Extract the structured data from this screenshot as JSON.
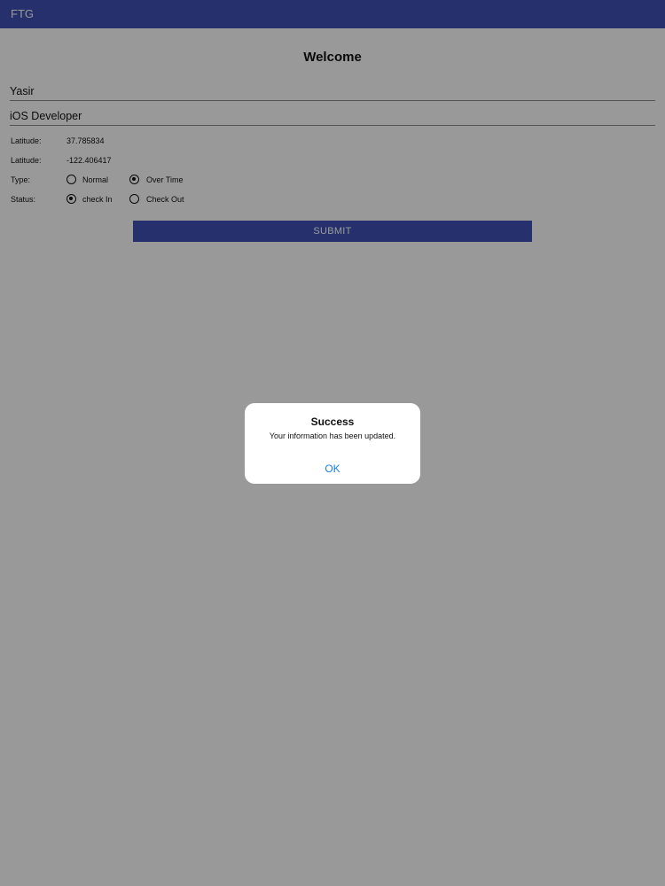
{
  "navbar": {
    "title": "FTG",
    "color": "#3f51b5"
  },
  "form": {
    "title": "Welcome",
    "name_value": "Yasir",
    "role_value": "iOS Developer",
    "latitude_label": "Latitude:",
    "latitude_value": "37.785834",
    "longitude_label": "Latitude:",
    "longitude_value": "-122.406417",
    "type": {
      "label": "Type:",
      "options": [
        {
          "label": "Normal",
          "selected": false
        },
        {
          "label": "Over Time",
          "selected": true
        }
      ]
    },
    "status": {
      "label": "Status:",
      "options": [
        {
          "label": "check In",
          "selected": true
        },
        {
          "label": "Check Out",
          "selected": false
        }
      ]
    },
    "submit_label": "SUBMIT"
  },
  "alert": {
    "title": "Success",
    "message": "Your information has been updated.",
    "ok_label": "OK",
    "ok_color": "#1a7fe6"
  }
}
